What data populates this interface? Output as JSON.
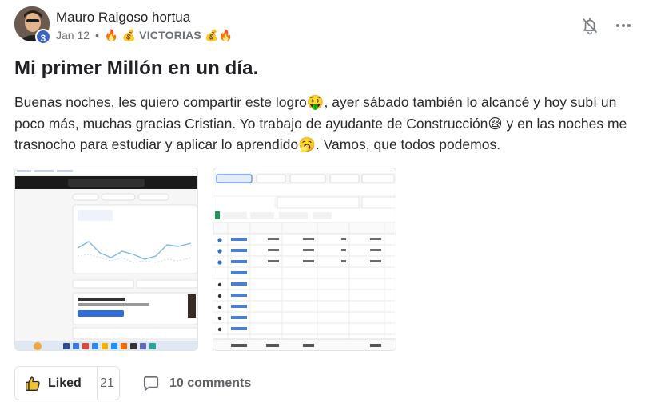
{
  "author": {
    "name": "Mauro Raigoso hortua",
    "level": "3"
  },
  "meta": {
    "date": "Jan 12",
    "separator": "•",
    "category": "🔥 💰 VICTORIAS 💰🔥"
  },
  "post": {
    "title": "Mi primer Millón en un día.",
    "body_lines": [
      "Buenas noches, les quiero compartir este logro🤑, ayer sábado también lo alcancé y hoy subí un",
      "poco más, muchas gracias Cristian. Yo trabajo de ayudante de Construcción😪 y en las noches me",
      "trasnocho para estudiar y aplicar lo aprendido🥱. Vamos, que todos podemos."
    ]
  },
  "images": [
    {
      "alt": "Shopify dashboard screenshot"
    },
    {
      "alt": "Facebook Ads campaign results screenshot"
    }
  ],
  "reactions": {
    "like_label": "Liked",
    "like_count": "21",
    "comments_label": "10 comments"
  },
  "colors": {
    "badge": "#3b63c7",
    "text": "#202124",
    "muted": "#6b6f76"
  },
  "icons": {
    "bell": "bell-off-icon",
    "more": "more-horizontal-icon",
    "like": "thumbs-up-icon",
    "comment": "comment-icon"
  }
}
